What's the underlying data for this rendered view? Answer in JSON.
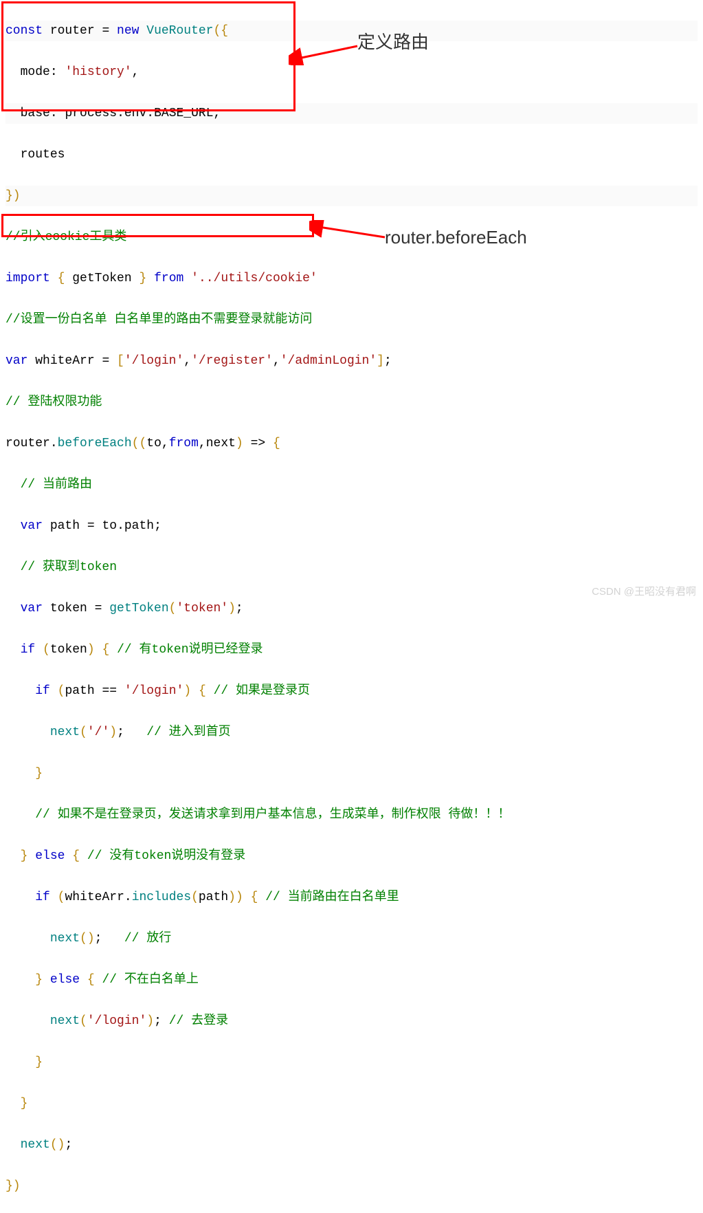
{
  "annotations": {
    "label1": "定义路由",
    "label2": "router.beforeEach"
  },
  "watermark": "CSDN @王昭没有君啊",
  "code": {
    "l1": {
      "kw_const": "const",
      "router": "router",
      "eq": " = ",
      "kw_new": "new",
      "sp": " ",
      "vuerouter": "VueRouter",
      "open": "({"
    },
    "l2": {
      "indent": "  ",
      "mode": "mode",
      "colon": ": ",
      "str": "'history'",
      "comma": ","
    },
    "l3": {
      "indent": "  ",
      "base": "base",
      "colon": ": ",
      "process": "process",
      "dot1": ".",
      "env": "env",
      "dot2": ".",
      "baseurl": "BASE_URL",
      "comma": ","
    },
    "l4": {
      "indent": "  ",
      "routes": "routes"
    },
    "l5": {
      "close": "})"
    },
    "l6": {
      "cmt": "//引入cookie工具类"
    },
    "l7": {
      "import": "import",
      "sp1": " ",
      "lb": "{",
      "sp2": " ",
      "gettoken": "getToken",
      "sp3": " ",
      "rb": "}",
      "sp4": " ",
      "from": "from",
      "sp5": " ",
      "path": "'../utils/cookie'"
    },
    "l8": {
      "cmt": "//设置一份白名单 白名单里的路由不需要登录就能访问"
    },
    "l9": {
      "var": "var",
      "sp": " ",
      "name": "whiteArr",
      "eq": " = ",
      "lb": "[",
      "s1": "'/login'",
      "c1": ",",
      "s2": "'/register'",
      "c2": ",",
      "s3": "'/adminLogin'",
      "rb": "]",
      "semi": ";"
    },
    "l10": {
      "cmt": "// 登陆权限功能"
    },
    "l11": {
      "router": "router",
      "dot": ".",
      "be": "beforeEach",
      "lp": "(",
      "lp2": "(",
      "to": "to",
      "c1": ",",
      "from": "from",
      "c2": ",",
      "next": "next",
      "rp": ")",
      "arrow": " => ",
      "lb": "{"
    },
    "l12": {
      "indent": "  ",
      "cmt": "// 当前路由"
    },
    "l13": {
      "indent": "  ",
      "var": "var",
      "sp": " ",
      "path": "path",
      "eq": " = ",
      "to": "to",
      "dot": ".",
      "prop": "path",
      "semi": ";"
    },
    "l14": {
      "indent": "  ",
      "cmt": "// 获取到token"
    },
    "l15": {
      "indent": "  ",
      "var": "var",
      "sp": " ",
      "token": "token",
      "eq": " = ",
      "fn": "getToken",
      "lp": "(",
      "str": "'token'",
      "rp": ")",
      "semi": ";"
    },
    "l16": {
      "indent": "  ",
      "if": "if",
      "sp": " ",
      "lp": "(",
      "token": "token",
      "rp": ")",
      "sp2": " ",
      "lb": "{",
      "sp3": " ",
      "cmt": "// 有token说明已经登录"
    },
    "l17": {
      "indent": "    ",
      "if": "if",
      "sp": " ",
      "lp": "(",
      "path": "path",
      "eq": " == ",
      "str": "'/login'",
      "rp": ")",
      "sp2": " ",
      "lb": "{",
      "sp3": " ",
      "cmt": "// 如果是登录页"
    },
    "l18": {
      "indent": "      ",
      "next": "next",
      "lp": "(",
      "str": "'/'",
      "rp": ")",
      "semi": ";",
      "sp": "   ",
      "cmt": "// 进入到首页"
    },
    "l19": {
      "indent": "    ",
      "rb": "}"
    },
    "l20": {
      "indent": "    ",
      "cmt": "// 如果不是在登录页，发送请求拿到用户基本信息，生成菜单，制作权限 待做！！！"
    },
    "l21": {
      "indent": "  ",
      "rb": "}",
      "sp": " ",
      "else": "else",
      "sp2": " ",
      "lb": "{",
      "sp3": " ",
      "cmt": "// 没有token说明没有登录"
    },
    "l22": {
      "indent": "    ",
      "if": "if",
      "sp": " ",
      "lp": "(",
      "arr": "whiteArr",
      "dot": ".",
      "inc": "includes",
      "lp2": "(",
      "path": "path",
      "rp2": ")",
      "rp": ")",
      "sp2": " ",
      "lb": "{",
      "sp3": " ",
      "cmt": "// 当前路由在白名单里"
    },
    "l23": {
      "indent": "      ",
      "next": "next",
      "lp": "(",
      "rp": ")",
      "semi": ";",
      "sp": "   ",
      "cmt": "// 放行"
    },
    "l24": {
      "indent": "    ",
      "rb": "}",
      "sp": " ",
      "else": "else",
      "sp2": " ",
      "lb": "{",
      "sp3": " ",
      "cmt": "// 不在白名单上"
    },
    "l25": {
      "indent": "      ",
      "next": "next",
      "lp": "(",
      "str": "'/login'",
      "rp": ")",
      "semi": ";",
      "sp": " ",
      "cmt": "// 去登录"
    },
    "l26": {
      "indent": "    ",
      "rb": "}"
    },
    "l27": {
      "indent": "  ",
      "rb": "}"
    },
    "l28": {
      "indent": "  ",
      "next": "next",
      "lp": "(",
      "rp": ")",
      "semi": ";"
    },
    "l29": {
      "close": "})"
    }
  }
}
